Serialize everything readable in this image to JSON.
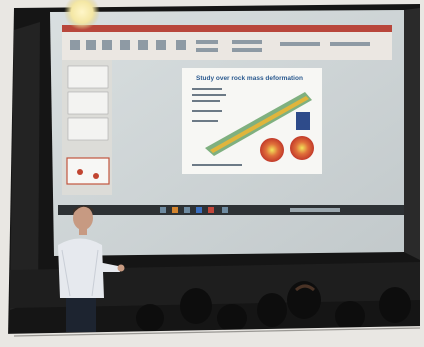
{
  "slide": {
    "title": "Study over rock mass deformation"
  },
  "scene": {
    "projector_lens_icon": "projector-light-icon",
    "presenter_icon": "person-icon",
    "audience_icon": "audience-heads-icon"
  }
}
